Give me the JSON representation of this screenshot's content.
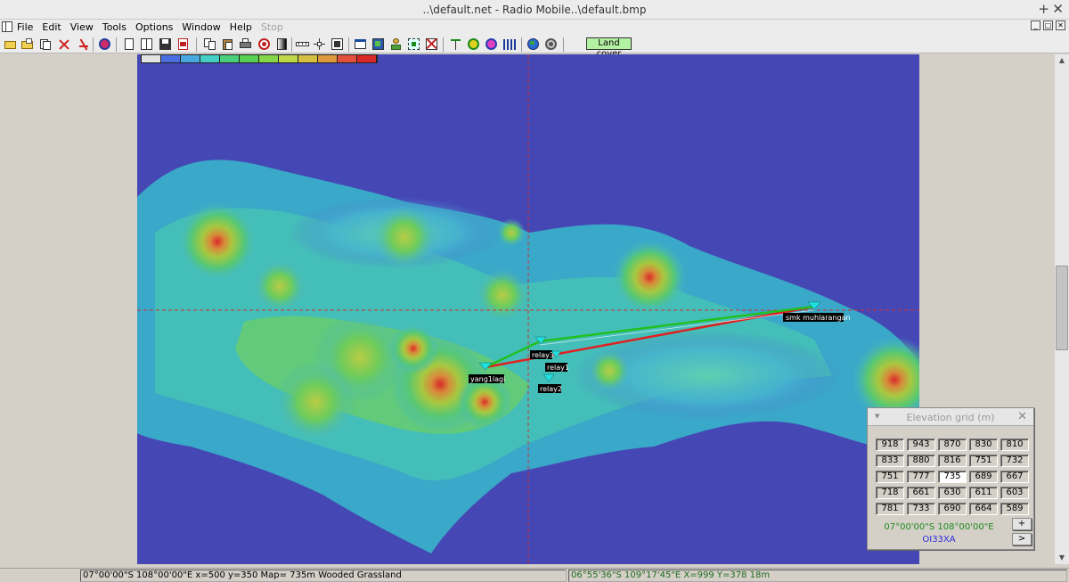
{
  "window": {
    "title": "..\\default.net - Radio Mobile..\\default.bmp",
    "plus_glyph": "+",
    "close_glyph": "✕"
  },
  "menu": {
    "items": [
      "File",
      "Edit",
      "View",
      "Tools",
      "Options",
      "Window",
      "Help"
    ],
    "disabled_item": "Stop",
    "win_controls": [
      "_",
      "□",
      "✕"
    ]
  },
  "toolbar": {
    "land_cover_label": "Land cover",
    "icons": [
      "open-folder-icon",
      "open-file-icon",
      "copy-stack-icon",
      "network-red-icon",
      "network-props-icon",
      "globe-icon",
      "document-icon",
      "document-split-icon",
      "save-icon",
      "pdf-icon",
      "copy-icon",
      "paste-icon",
      "print-icon",
      "target-icon",
      "grayscale-icon",
      "ruler-icon",
      "move-icon",
      "crosshair-icon",
      "window-icon",
      "map-properties-icon",
      "people-icon",
      "select-area-icon",
      "delete-icon",
      "antenna-icon",
      "radio-link-icon",
      "coverage-icon",
      "spectrum-icon",
      "world-icon",
      "settings-icon"
    ]
  },
  "legend_colors": [
    "#e4e4e4",
    "#4a6ee0",
    "#4aa8e0",
    "#46cfc4",
    "#4acf7c",
    "#58d054",
    "#86d64a",
    "#bfd84a",
    "#d6c044",
    "#e0983c",
    "#e0503c",
    "#d82828"
  ],
  "map": {
    "crosshair_color": "#d03030",
    "stations": [
      {
        "name": "smk muhlarangan"
      },
      {
        "name": "relay3"
      },
      {
        "name": "relay1"
      },
      {
        "name": "yang1lagi"
      },
      {
        "name": "relay2"
      }
    ],
    "links": [
      {
        "from": "yang1lagi",
        "to": "smk muhlarangan",
        "color": "#e02020"
      },
      {
        "from": "yang1lagi",
        "to": "relay3",
        "color": "#20c020"
      },
      {
        "from": "relay3",
        "to": "smk muhlarangan",
        "color": "#20c020"
      }
    ]
  },
  "elevation_grid": {
    "title": "Elevation grid (m)",
    "menu_glyph": "▼",
    "close_glyph": "✕",
    "rows": [
      [
        "918",
        "943",
        "870",
        "830",
        "810"
      ],
      [
        "833",
        "880",
        "816",
        "751",
        "732"
      ],
      [
        "751",
        "777",
        "735",
        "689",
        "667"
      ],
      [
        "718",
        "661",
        "630",
        "611",
        "603"
      ],
      [
        "781",
        "733",
        "690",
        "664",
        "589"
      ]
    ],
    "coordinate": "07°00'00\"S  108°00'00\"E",
    "locator": "OI33XA",
    "plus_label": "+",
    "next_label": ">"
  },
  "statusbar": {
    "left": "07°00'00\"S  108°00'00\"E   x=500 y=350 Map= 735m Wooded Grassland",
    "right": "06°55'36\"S 109°17'45\"E   X=999 Y=378 18m"
  }
}
